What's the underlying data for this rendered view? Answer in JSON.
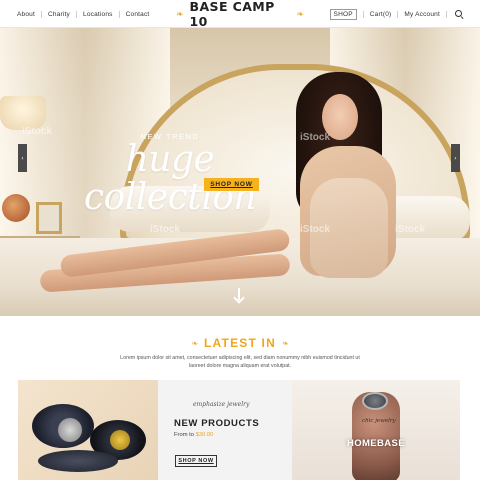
{
  "header": {
    "nav_left": [
      "About",
      "Charity",
      "Locations",
      "Contact"
    ],
    "logo": "BASE CAMP 10",
    "shop": "SHOP",
    "cart": "Cart(0)",
    "account": "My Account",
    "search_icon": "search-icon"
  },
  "hero": {
    "kicker": "NEW TREND",
    "headline": "huge collection",
    "cta": "SHOP NOW",
    "prev_icon": "chevron-left-icon",
    "next_icon": "chevron-right-icon",
    "scroll_icon": "arrow-down-icon",
    "watermark": "iStock"
  },
  "latest": {
    "title": "LATEST IN",
    "description": "Lorem ipsum dolor sit amet, consectetuer adipiscing elit, sed diam nonummy nibh euismod tincidunt ut laoreet dolore magna aliquam erat volutpat."
  },
  "products": {
    "script": "emphasize jewelry",
    "title": "NEW PRODUCTS",
    "from_label": "From to",
    "price": "$30.00",
    "cta": "SHOP NOW"
  },
  "homebase": {
    "script": "chic jewelry",
    "title": "HOMEBASE"
  },
  "colors": {
    "accent": "#f5b21e",
    "logo_wing": "#e8a93a",
    "text": "#222222"
  }
}
